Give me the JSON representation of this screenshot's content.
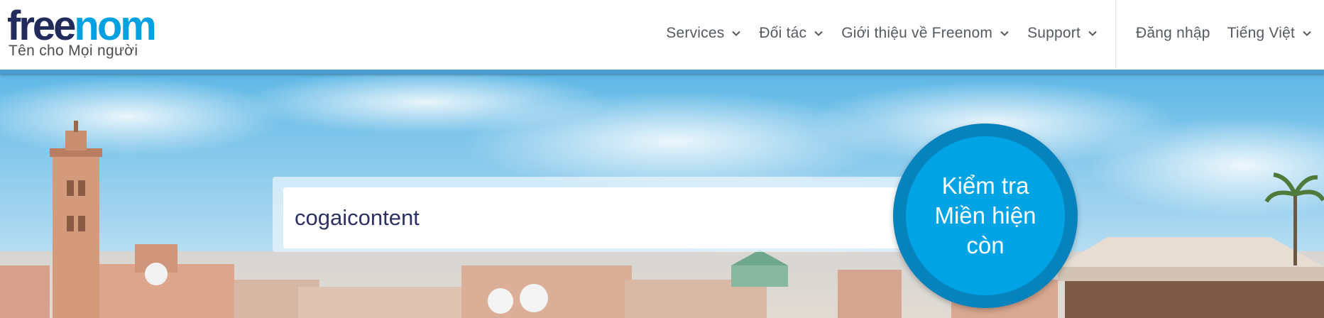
{
  "logo": {
    "word_part1": "free",
    "word_part2": "nom",
    "tagline": "Tên cho Mọi người",
    "colors": {
      "dark": "#232a5c",
      "light": "#00a1e0"
    }
  },
  "nav": {
    "items": [
      {
        "label": "Services",
        "icon": "chevron-down-icon"
      },
      {
        "label": "Đối tác",
        "icon": "chevron-down-icon"
      },
      {
        "label": "Giới thiệu về Freenom",
        "icon": "chevron-down-icon"
      },
      {
        "label": "Support",
        "icon": "chevron-down-icon"
      }
    ],
    "login": "Đăng nhập",
    "language": {
      "label": "Tiếng Việt",
      "icon": "chevron-down-icon"
    }
  },
  "search": {
    "value": "cogaicontent",
    "button_label": "Kiểm tra\nMiền hiện\ncòn"
  },
  "colors": {
    "accent": "#00a4e4",
    "accent_dark": "#0683bd",
    "header_bar": "#4a9fd0",
    "nav_text": "#555a60"
  }
}
